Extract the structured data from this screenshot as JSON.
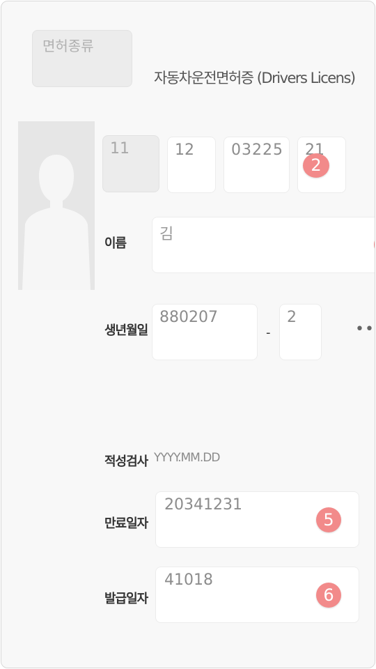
{
  "license_type": {
    "placeholder": "면허종류"
  },
  "header": {
    "title": "자동차운전면허증 (Drivers Licens)"
  },
  "license_number": {
    "part1": "11",
    "part2": "12",
    "part3": "03225",
    "part4": "21"
  },
  "badges": {
    "b2": "2",
    "b5": "5",
    "b6": "6"
  },
  "name": {
    "label": "이름",
    "value": "김"
  },
  "birth": {
    "label": "생년월일",
    "value": "880207",
    "separator": "-",
    "gender": "2",
    "more": "•••"
  },
  "aptitude": {
    "label": "적성검사",
    "placeholder": "YYYY.MM.DD"
  },
  "expiry": {
    "label": "만료일자",
    "value": "20341231"
  },
  "issue": {
    "label": "발급일자",
    "value": "41018"
  },
  "colors": {
    "badge": "#f28a8a",
    "field_bg": "#ffffff",
    "disabled_bg": "#ececec",
    "card_bg": "#f8f8f8"
  }
}
